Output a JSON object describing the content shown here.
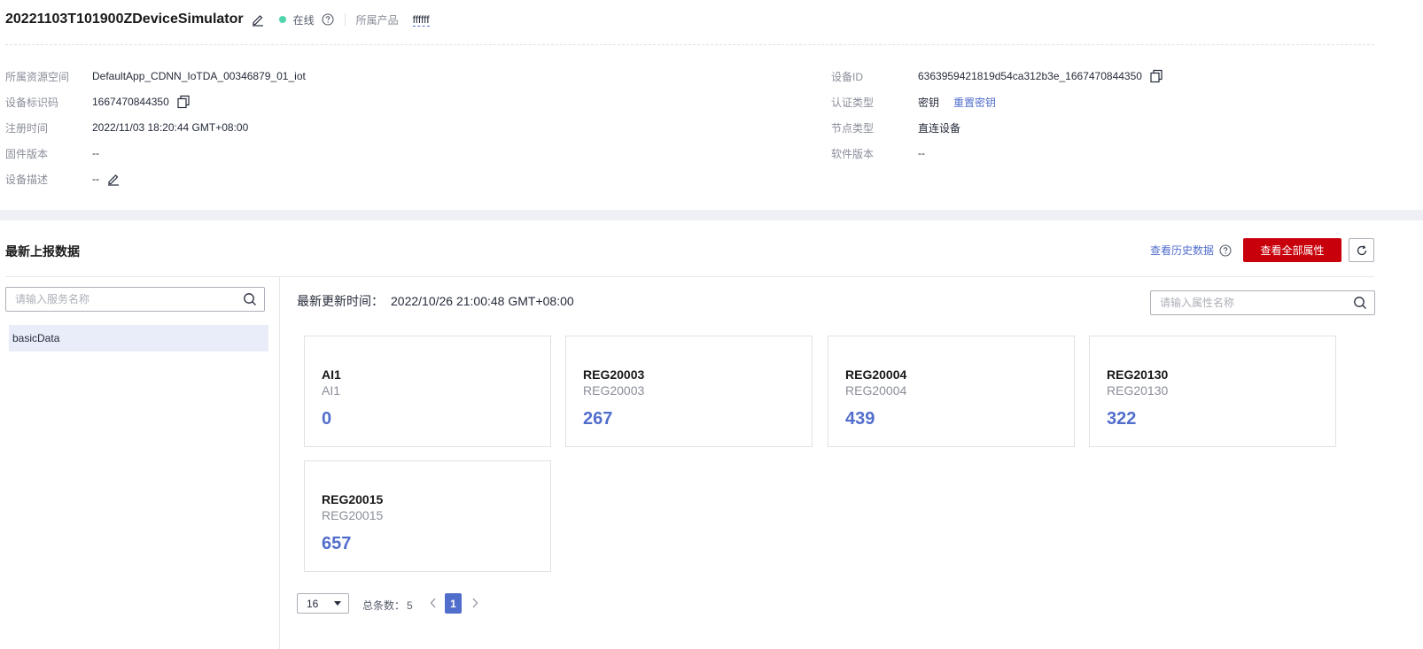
{
  "header": {
    "device_name": "20221103T101900ZDeviceSimulator",
    "status": "在线",
    "product_label": "所属产品",
    "product_name": "ffffff",
    "status_color": "#50d4ab"
  },
  "info": {
    "left": [
      {
        "label": "所属资源空间",
        "value": "DefaultApp_CDNN_IoTDA_00346879_01_iot"
      },
      {
        "label": "设备标识码",
        "value": "1667470844350"
      },
      {
        "label": "注册时间",
        "value": "2022/11/03 18:20:44 GMT+08:00"
      },
      {
        "label": "固件版本",
        "value": "--"
      },
      {
        "label": "设备描述",
        "value": "--"
      }
    ],
    "right": [
      {
        "label": "设备ID",
        "value": "6363959421819d54ca312b3e_1667470844350"
      },
      {
        "label": "认证类型",
        "value": "密钥",
        "link": "重置密钥"
      },
      {
        "label": "节点类型",
        "value": "直连设备"
      },
      {
        "label": "软件版本",
        "value": "--"
      }
    ]
  },
  "data_section": {
    "title": "最新上报数据",
    "history_link": "查看历史数据",
    "view_all_button": "查看全部属性",
    "service_search_placeholder": "请输入服务名称",
    "property_search_placeholder": "请输入属性名称",
    "services": [
      "basicData"
    ],
    "update_label": "最新更新时间：",
    "update_time": "2022/10/26 21:00:48 GMT+08:00",
    "properties": [
      {
        "name": "AI1",
        "sub": "AI1",
        "value": "0"
      },
      {
        "name": "REG20003",
        "sub": "REG20003",
        "value": "267"
      },
      {
        "name": "REG20004",
        "sub": "REG20004",
        "value": "439"
      },
      {
        "name": "REG20130",
        "sub": "REG20130",
        "value": "322"
      },
      {
        "name": "REG20015",
        "sub": "REG20015",
        "value": "657"
      }
    ]
  },
  "pagination": {
    "page_size": "16",
    "total_label": "总条数：",
    "total": "5",
    "current_page": "1"
  },
  "colors": {
    "accent": "#526ecc",
    "primary_button": "#c7000b"
  }
}
